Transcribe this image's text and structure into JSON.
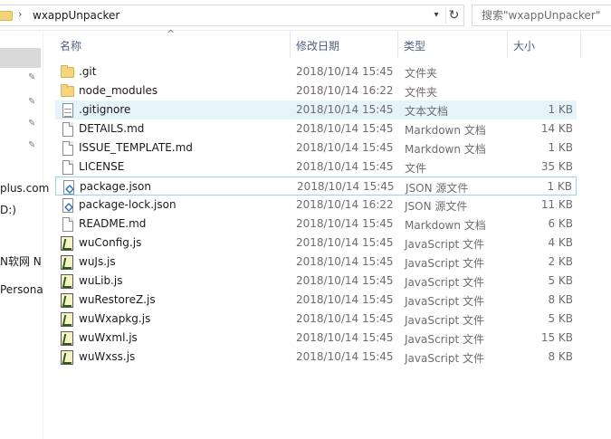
{
  "address": {
    "separator": "›",
    "path": "wxappUnpacker",
    "dropdown_glyph": "▾",
    "refresh_glyph": "↻"
  },
  "search": {
    "placeholder": "搜索\"wxappUnpacker\""
  },
  "columns": {
    "name": "名称",
    "date": "修改日期",
    "type": "类型",
    "size": "大小",
    "sort_glyph": "^"
  },
  "nav": {
    "pin_glyph": "✎",
    "items": [
      {
        "label": "plus.com"
      },
      {
        "label": "D:)"
      },
      {
        "label": "N软网 N"
      },
      {
        "label": "Persona"
      }
    ]
  },
  "files": [
    {
      "name": ".git",
      "date": "2018/10/14 15:45",
      "type": "文件夹",
      "size": "",
      "icon": "folder-icon"
    },
    {
      "name": "node_modules",
      "date": "2018/10/14 16:22",
      "type": "文件夹",
      "size": "",
      "icon": "folder-icon"
    },
    {
      "name": ".gitignore",
      "date": "2018/10/14 15:45",
      "type": "文本文档",
      "size": "1 KB",
      "icon": "text-file-icon"
    },
    {
      "name": "DETAILS.md",
      "date": "2018/10/14 15:45",
      "type": "Markdown 文档",
      "size": "14 KB",
      "icon": "document-icon"
    },
    {
      "name": "ISSUE_TEMPLATE.md",
      "date": "2018/10/14 15:45",
      "type": "Markdown 文档",
      "size": "1 KB",
      "icon": "document-icon"
    },
    {
      "name": "LICENSE",
      "date": "2018/10/14 15:45",
      "type": "文件",
      "size": "35 KB",
      "icon": "document-icon"
    },
    {
      "name": "package.json",
      "date": "2018/10/14 15:45",
      "type": "JSON 源文件",
      "size": "1 KB",
      "icon": "json-file-icon"
    },
    {
      "name": "package-lock.json",
      "date": "2018/10/14 16:22",
      "type": "JSON 源文件",
      "size": "11 KB",
      "icon": "json-file-icon"
    },
    {
      "name": "README.md",
      "date": "2018/10/14 15:45",
      "type": "Markdown 文档",
      "size": "6 KB",
      "icon": "document-icon"
    },
    {
      "name": "wuConfig.js",
      "date": "2018/10/14 15:45",
      "type": "JavaScript 文件",
      "size": "4 KB",
      "icon": "javascript-file-icon"
    },
    {
      "name": "wuJs.js",
      "date": "2018/10/14 15:45",
      "type": "JavaScript 文件",
      "size": "2 KB",
      "icon": "javascript-file-icon"
    },
    {
      "name": "wuLib.js",
      "date": "2018/10/14 15:45",
      "type": "JavaScript 文件",
      "size": "5 KB",
      "icon": "javascript-file-icon"
    },
    {
      "name": "wuRestoreZ.js",
      "date": "2018/10/14 15:45",
      "type": "JavaScript 文件",
      "size": "8 KB",
      "icon": "javascript-file-icon"
    },
    {
      "name": "wuWxapkg.js",
      "date": "2018/10/14 15:45",
      "type": "JavaScript 文件",
      "size": "5 KB",
      "icon": "javascript-file-icon"
    },
    {
      "name": "wuWxml.js",
      "date": "2018/10/14 15:45",
      "type": "JavaScript 文件",
      "size": "15 KB",
      "icon": "javascript-file-icon"
    },
    {
      "name": "wuWxss.js",
      "date": "2018/10/14 15:45",
      "type": "JavaScript 文件",
      "size": "8 KB",
      "icon": "javascript-file-icon"
    }
  ],
  "state": {
    "hover_index": 2,
    "focused_index": 6
  }
}
